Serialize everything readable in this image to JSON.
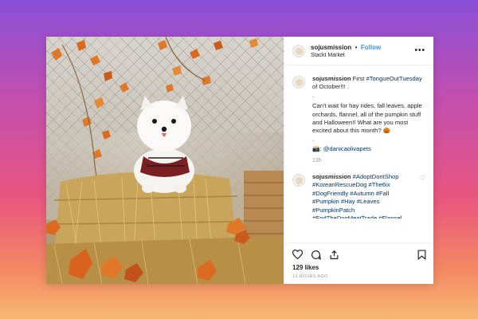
{
  "post": {
    "username": "sojusmission",
    "follow_label": "Follow",
    "separator": "•",
    "location": "Stackt Market",
    "more_icon": "more-options-icon",
    "caption": {
      "username": "sojusmission",
      "line1_prefix": "First ",
      "hashtag": "#TongueOutTuesday",
      "line1_suffix": " of October!!! .",
      "dot": ".",
      "paragraph": "Can't wait for hay rides, fall leaves, apple orchards, flannel, all of the pumpkin stuff and Halloween!! What are you most excited about this month? 🎃",
      "dot2": ".",
      "camera": "📸",
      "mention_prefix": ": ",
      "mention": "@danicaolivapets",
      "time": "13h"
    },
    "comment": {
      "username": "sojusmission",
      "text": "#AdoptDontShop #KoreanRescueDog #The6ix #DogFriendly #Autumn #Fall #Pumpkin #Hay #Leaves #PumpkinPatch #EndTheDogMeatTrade #Flannel #SweaterWeather #DogsOfInstagram #Pomeranian"
    },
    "likes": "129 likes",
    "posted": "13 HOURS AGO",
    "icons": {
      "like": "heart-icon",
      "comment": "comment-icon",
      "share": "share-icon",
      "save": "bookmark-icon"
    }
  }
}
